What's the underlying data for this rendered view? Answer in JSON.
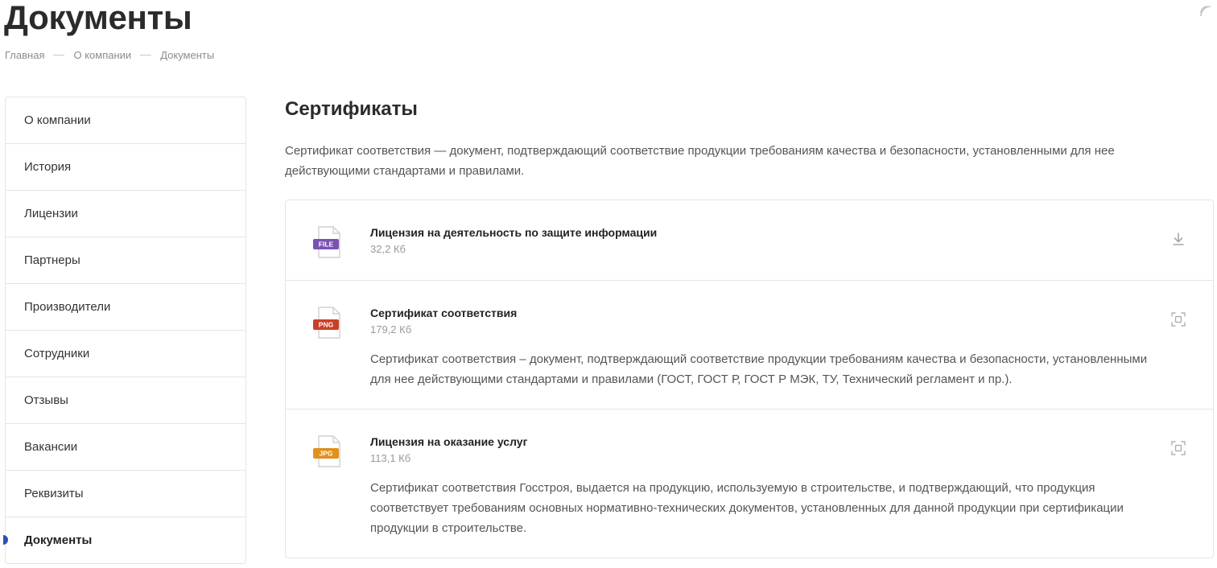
{
  "header": {
    "title": "Документы"
  },
  "breadcrumb": {
    "items": [
      "Главная",
      "О компании",
      "Документы"
    ]
  },
  "sidebar": {
    "items": [
      {
        "label": "О компании"
      },
      {
        "label": "История"
      },
      {
        "label": "Лицензии"
      },
      {
        "label": "Партнеры"
      },
      {
        "label": "Производители"
      },
      {
        "label": "Сотрудники"
      },
      {
        "label": "Отзывы"
      },
      {
        "label": "Вакансии"
      },
      {
        "label": "Реквизиты"
      },
      {
        "label": "Документы",
        "active": true
      }
    ]
  },
  "main": {
    "section_title": "Сертификаты",
    "section_desc": "Сертификат соответствия — документ, подтверждающий соответствие продукции требованиям качества и безопасности, установленными для нее действующими стандартами и правилами.",
    "documents": [
      {
        "type_label": "FILE",
        "type_color": "#7a52b3",
        "title": "Лицензия на деятельность по защите информации",
        "size": "32,2 Кб",
        "description": "",
        "action_icon": "download-icon"
      },
      {
        "type_label": "PNG",
        "type_color": "#c8402a",
        "title": "Сертификат соответствия",
        "size": "179,2 Кб",
        "description": "Сертификат соответствия – документ, подтверждающий соответствие продукции требованиям качества и безопасности, установленными для нее действующими стандартами и правилами (ГОСТ, ГОСТ Р, ГОСТ Р МЭК, ТУ, Технический регламент и пр.).",
        "action_icon": "zoom-icon"
      },
      {
        "type_label": "JPG",
        "type_color": "#e0901c",
        "title": "Лицензия на оказание услуг",
        "size": "113,1 Кб",
        "description": "Сертификат соответствия Госстроя, выдается на продукцию, используемую в строительстве, и подтверждающий, что продукция соответствует требованиям основных нормативно-технических документов, установленных для данной продукции при сертификации продукции в строительстве.",
        "action_icon": "zoom-icon"
      }
    ]
  },
  "colors": {
    "accent": "#2d4fb8",
    "border": "#e5e5e5",
    "muted_text": "#999999"
  }
}
